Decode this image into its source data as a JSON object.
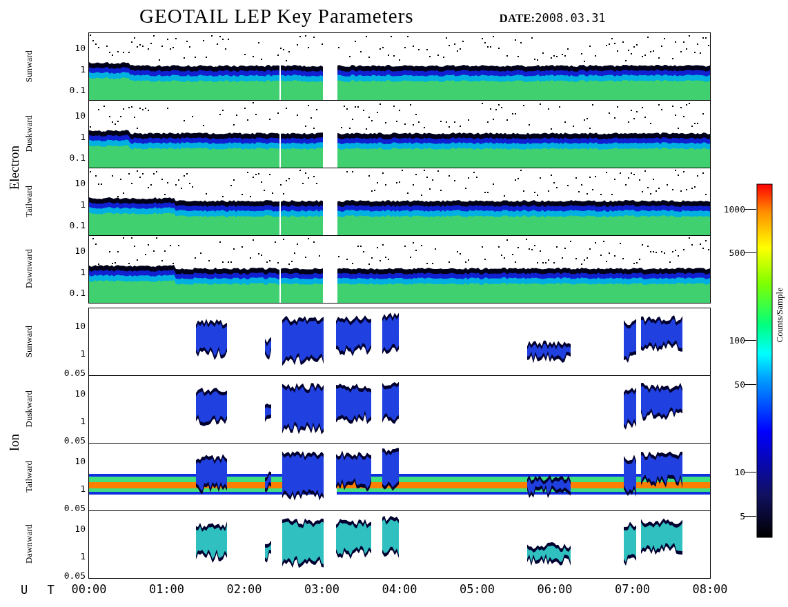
{
  "title": "GEOTAIL LEP Key Parameters",
  "date": {
    "label": "DATE:",
    "value": "2008.03.31"
  },
  "groups": [
    {
      "label": "Electron",
      "kind": "electron",
      "panels": [
        {
          "label": "Sunward",
          "yticks": [
            "10",
            "1",
            "0.1"
          ]
        },
        {
          "label": "Duskward",
          "yticks": [
            "10",
            "1",
            "0.1"
          ]
        },
        {
          "label": "Tailward",
          "yticks": [
            "10",
            "1",
            "0.1"
          ]
        },
        {
          "label": "Dawnward",
          "yticks": [
            "10",
            "1",
            "0.1"
          ]
        }
      ]
    },
    {
      "label": "Ion",
      "kind": "ion",
      "panels": [
        {
          "label": "Sunward",
          "yticks": [
            "10",
            "1",
            "0.05"
          ]
        },
        {
          "label": "Duskward",
          "yticks": [
            "10",
            "1",
            "0.05"
          ]
        },
        {
          "label": "Tailward",
          "yticks": [
            "10",
            "1",
            "0.05"
          ]
        },
        {
          "label": "Dawnward",
          "yticks": [
            "10",
            "1",
            "0.05"
          ]
        }
      ]
    }
  ],
  "time_axis": {
    "label": "U T",
    "ticks": [
      "00:00",
      "01:00",
      "02:00",
      "03:00",
      "04:00",
      "05:00",
      "06:00",
      "07:00",
      "08:00"
    ]
  },
  "colorbar": {
    "label": "Counts/Sample",
    "ticks": [
      "1000",
      "500",
      "100",
      "50",
      "10",
      "5"
    ]
  }
}
